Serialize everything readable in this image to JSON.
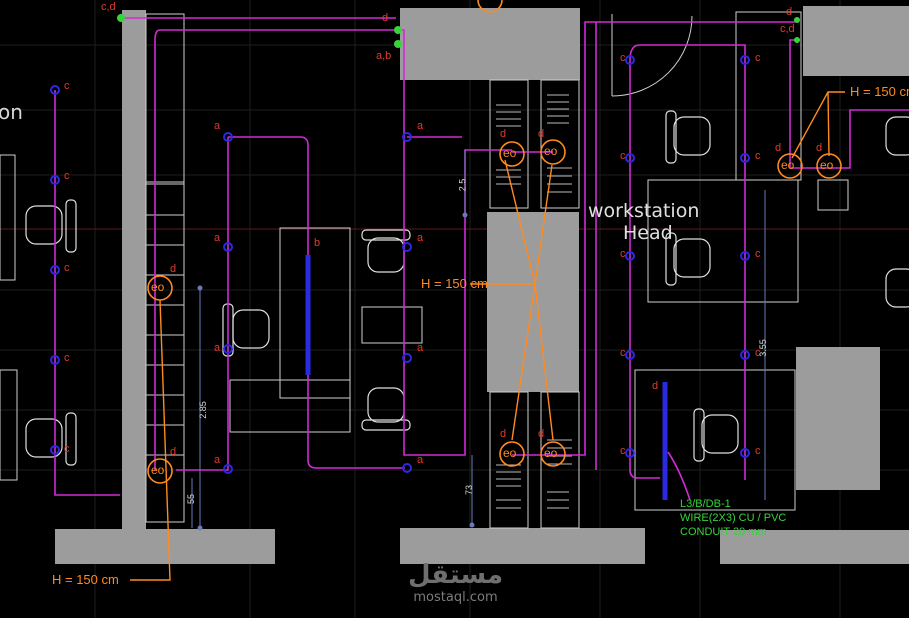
{
  "colors": {
    "background": "#000000",
    "grid": "#1b1b1b",
    "wall": "#9c9c9c",
    "circuit": "#d02bd6",
    "callout": "#ff8a1f",
    "fixture": "#2a2ae0",
    "label_white": "#e6e6e6",
    "green": "#35d43a",
    "letter": "#e13a2a"
  },
  "room_labels": {
    "left_partial": "on",
    "workstation_line1": "workstation",
    "workstation_line2": "Head"
  },
  "height_labels": {
    "bottom_left": "H = 150 cm",
    "center": "H = 150 cm",
    "top_right": "H = 150 cm"
  },
  "panel_note": {
    "line1": "L3/B/DB-1",
    "line2": "WIRE(2X3) CU / PVC",
    "line3": "CONDUIT 20 mm"
  },
  "outlet_symbol": "eo",
  "circuit_letters": {
    "c": "c",
    "d": "d",
    "a": "a",
    "b": "b",
    "cd": "c,d",
    "ab": "a,b"
  },
  "dimensions": {
    "d1": "2.5",
    "d2": "2.85",
    "d3": "55",
    "d4": "73",
    "d5": "3.55"
  },
  "watermark": {
    "logo": "مستقل",
    "site": "mostaql.com"
  }
}
